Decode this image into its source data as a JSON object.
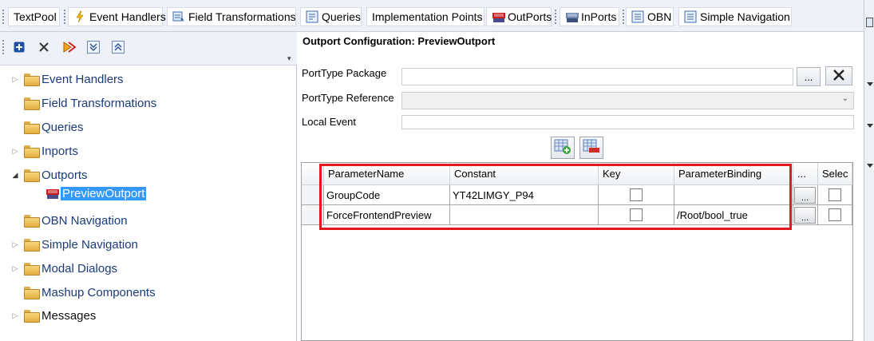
{
  "tabs": [
    {
      "label": "TextPool",
      "icon": "none"
    },
    {
      "label": "Event Handlers",
      "icon": "lightning-icon"
    },
    {
      "label": "Field Transformations",
      "icon": "transform-icon"
    },
    {
      "label": "Queries",
      "icon": "query-icon"
    },
    {
      "label": "Implementation Points",
      "icon": "none"
    },
    {
      "label": "OutPorts",
      "icon": "outport-icon"
    },
    {
      "label": "InPorts",
      "icon": "inport-icon"
    },
    {
      "label": "OBN",
      "icon": "obn-icon"
    },
    {
      "label": "Simple Navigation",
      "icon": "navigation-icon"
    }
  ],
  "tree": [
    {
      "label": "Event Handlers",
      "expandable": true
    },
    {
      "label": "Field Transformations",
      "expandable": false
    },
    {
      "label": "Queries",
      "expandable": false
    },
    {
      "label": "Inports",
      "expandable": true
    },
    {
      "label": "Outports",
      "expandable": true,
      "expanded": true
    },
    {
      "label": "PreviewOutport",
      "selected": true
    },
    {
      "label": "OBN Navigation",
      "expandable": false
    },
    {
      "label": "Simple Navigation",
      "expandable": true
    },
    {
      "label": "Modal Dialogs",
      "expandable": true
    },
    {
      "label": "Mashup Components",
      "expandable": false
    },
    {
      "label": "Messages",
      "expandable": true
    }
  ],
  "config": {
    "title": "Outport Configuration: PreviewOutport",
    "porttype_package_label": "PortType Package",
    "porttype_package_value": "",
    "porttype_reference_label": "PortType Reference",
    "porttype_reference_value": "",
    "local_event_label": "Local Event",
    "local_event_value": "",
    "browse_label": "..."
  },
  "grid": {
    "headers": [
      "ParameterName",
      "Constant",
      "Key",
      "ParameterBinding",
      "...",
      "Selec"
    ],
    "rows": [
      {
        "name": "GroupCode",
        "constant": "YT42LIMGY_P94",
        "key": false,
        "binding": "",
        "select": false
      },
      {
        "name": "ForceFrontendPreview",
        "constant": "",
        "key": false,
        "binding": "/Root/bool_true",
        "select": false
      }
    ],
    "row_button_label": "..."
  },
  "colors": {
    "highlight": "#e0191e",
    "selection": "#3399ff"
  }
}
